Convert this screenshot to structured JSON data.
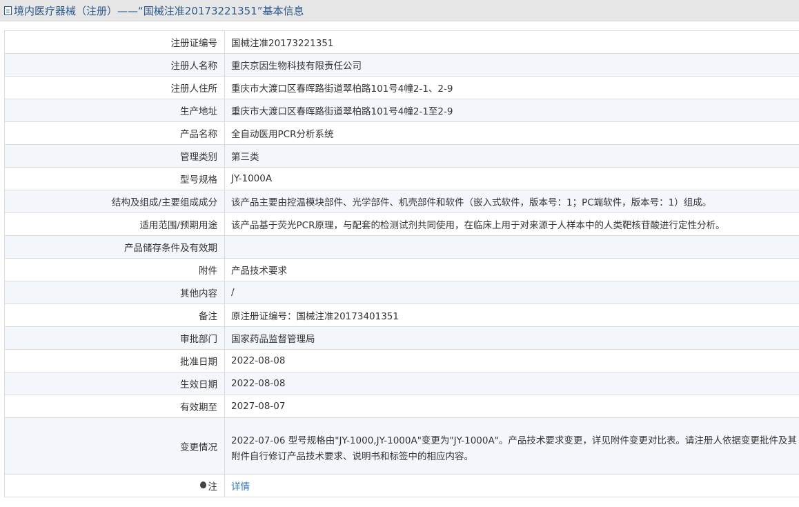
{
  "header": {
    "title": "境内医疗器械（注册）——“国械注准20173221351”基本信息",
    "icon": "document-icon"
  },
  "rows": [
    {
      "label": "注册证编号",
      "value": "国械注准20173221351"
    },
    {
      "label": "注册人名称",
      "value": "重庆京因生物科技有限责任公司"
    },
    {
      "label": "注册人住所",
      "value": "重庆市大渡口区春晖路街道翠柏路101号4幢2-1、2-9"
    },
    {
      "label": "生产地址",
      "value": "重庆市大渡口区春晖路街道翠柏路101号4幢2-1至2-9"
    },
    {
      "label": "产品名称",
      "value": "全自动医用PCR分析系统"
    },
    {
      "label": "管理类别",
      "value": "第三类"
    },
    {
      "label": "型号规格",
      "value": "JY-1000A"
    },
    {
      "label": "结构及组成/主要组成成分",
      "value": "该产品主要由控温模块部件、光学部件、机壳部件和软件（嵌入式软件，版本号：1；PC端软件，版本号：1）组成。"
    },
    {
      "label": "适用范围/预期用途",
      "value": "该产品基于荧光PCR原理，与配套的检测试剂共同使用，在临床上用于对来源于人样本中的人类靶核苷酸进行定性分析。"
    },
    {
      "label": "产品储存条件及有效期",
      "value": ""
    },
    {
      "label": "附件",
      "value": "产品技术要求"
    },
    {
      "label": "其他内容",
      "value": "/"
    },
    {
      "label": "备注",
      "value": "原注册证编号：国械注准20173401351"
    },
    {
      "label": "审批部门",
      "value": "国家药品监督管理局"
    },
    {
      "label": "批准日期",
      "value": "2022-08-08"
    },
    {
      "label": "生效日期",
      "value": "2022-08-08"
    },
    {
      "label": "有效期至",
      "value": "2027-08-07"
    },
    {
      "label": "变更情况",
      "value": "2022-07-06 型号规格由\"JY-1000,JY-1000A\"变更为\"JY-1000A\"。产品技术要求变更，详见附件变更对比表。请注册人依据变更批件及其附件自行修订产品技术要求、说明书和标签中的相应内容。"
    }
  ],
  "note": {
    "label": "注",
    "icon": "lightbulb-icon",
    "link_text": "详情"
  },
  "colors": {
    "header_bg": "#e6e6e6",
    "header_text": "#2c5a8a",
    "alt_row_bg": "#f3f6fa",
    "border": "#dcdcdc",
    "link": "#2a72c0"
  }
}
